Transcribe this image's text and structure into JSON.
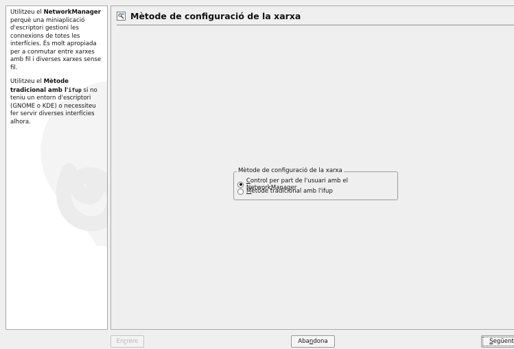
{
  "help": {
    "p1_pre": "Utilitzeu el ",
    "p1_bold": "NetworkManager",
    "p1_post": " perquè una miniaplicació d'escriptori gestioni les connexions de totes les interfícies. És molt apropiada per a conmutar entre xarxes amb fil i diverses xarxes sense fil.",
    "p2_pre": "Utilitzeu el ",
    "p2_bold": "Mètode tradicional amb l'",
    "p2_code": "ifup",
    "p2_post": " si no teniu un entorn d'escriptori (GNOME o KDE) o necessiteu fer servir diverses interfícies alhora."
  },
  "page": {
    "title": "Mètode de configuració de la xarxa",
    "title_icon": "network-config-icon"
  },
  "method_group": {
    "legend": "Mètode de configuració de la xarxa",
    "options": [
      {
        "mnemonic": "C",
        "rest": "ontrol per part de l'usuari amb el NetworkManager",
        "checked": true
      },
      {
        "mnemonic": "M",
        "rest": "ètode tradicional amb l'ifup",
        "checked": false
      }
    ]
  },
  "buttons": {
    "back": {
      "pre": "En",
      "mnemonic": "r",
      "post": "rere",
      "enabled": false
    },
    "abort": {
      "pre": "Aba",
      "mnemonic": "n",
      "post": "dona"
    },
    "next": {
      "pre": "",
      "mnemonic": "S",
      "post": "egüent"
    }
  }
}
